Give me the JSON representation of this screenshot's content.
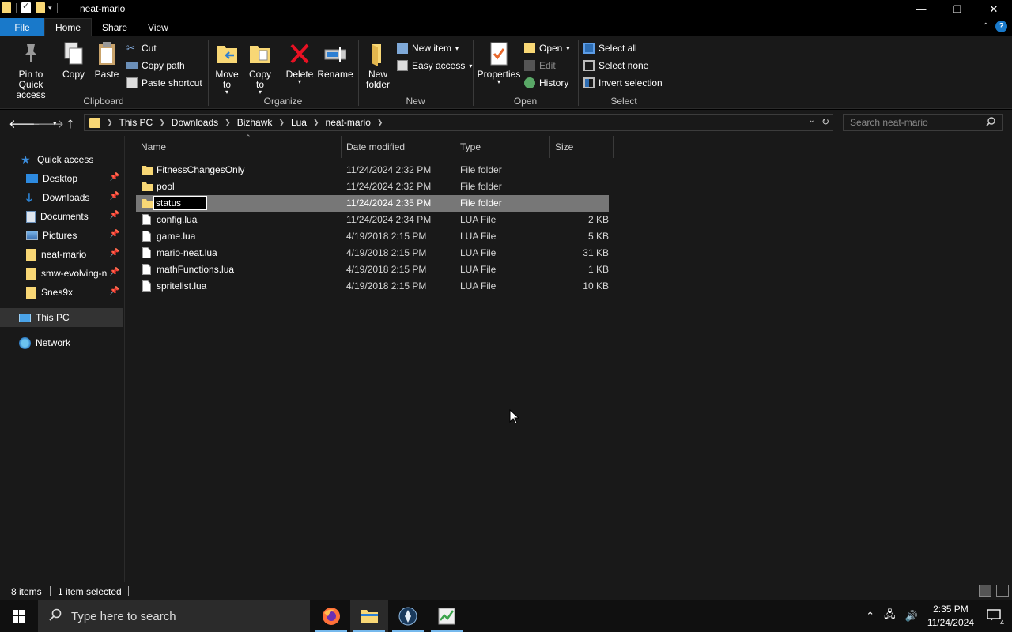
{
  "window": {
    "title": "neat-mario",
    "controls": [
      "—",
      "❐",
      "✕"
    ]
  },
  "ribbon_tabs": [
    "File",
    "Home",
    "Share",
    "View"
  ],
  "ribbon": {
    "clipboard": {
      "label": "Clipboard",
      "pin": "Pin to Quick access",
      "copy": "Copy",
      "paste": "Paste",
      "cut": "Cut",
      "copy_path": "Copy path",
      "paste_shortcut": "Paste shortcut"
    },
    "organize": {
      "label": "Organize",
      "move_to": "Move to",
      "copy_to": "Copy to",
      "delete": "Delete",
      "rename": "Rename"
    },
    "new": {
      "label": "New",
      "new_folder": "New folder",
      "new_item": "New item",
      "easy_access": "Easy access"
    },
    "open": {
      "label": "Open",
      "properties": "Properties",
      "open": "Open",
      "edit": "Edit",
      "history": "History"
    },
    "select": {
      "label": "Select",
      "select_all": "Select all",
      "select_none": "Select none",
      "invert": "Invert selection"
    }
  },
  "address": {
    "crumbs": [
      "This PC",
      "Downloads",
      "Bizhawk",
      "Lua",
      "neat-mario"
    ],
    "search_placeholder": "Search neat-mario"
  },
  "nav_pane": {
    "quick_access": "Quick access",
    "items": [
      {
        "label": "Desktop",
        "icon": "desktop-icon",
        "pinned": true
      },
      {
        "label": "Downloads",
        "icon": "download-icon",
        "pinned": true
      },
      {
        "label": "Documents",
        "icon": "documents-icon",
        "pinned": true
      },
      {
        "label": "Pictures",
        "icon": "pictures-icon",
        "pinned": true
      },
      {
        "label": "neat-mario",
        "icon": "folder-icon",
        "pinned": true
      },
      {
        "label": "smw-evolving-n",
        "icon": "folder-icon",
        "pinned": true
      },
      {
        "label": "Snes9x",
        "icon": "folder-icon",
        "pinned": true
      }
    ],
    "this_pc": "This PC",
    "network": "Network"
  },
  "columns": [
    "Name",
    "Date modified",
    "Type",
    "Size"
  ],
  "files": [
    {
      "name": "FitnessChangesOnly",
      "date": "11/24/2024 2:32 PM",
      "type": "File folder",
      "size": "",
      "kind": "folder"
    },
    {
      "name": "pool",
      "date": "11/24/2024 2:32 PM",
      "type": "File folder",
      "size": "",
      "kind": "folder"
    },
    {
      "name": "status",
      "date": "11/24/2024 2:35 PM",
      "type": "File folder",
      "size": "",
      "kind": "folder",
      "renaming": true
    },
    {
      "name": "config.lua",
      "date": "11/24/2024 2:34 PM",
      "type": "LUA File",
      "size": "2 KB",
      "kind": "file"
    },
    {
      "name": "game.lua",
      "date": "4/19/2018 2:15 PM",
      "type": "LUA File",
      "size": "5 KB",
      "kind": "file"
    },
    {
      "name": "mario-neat.lua",
      "date": "4/19/2018 2:15 PM",
      "type": "LUA File",
      "size": "31 KB",
      "kind": "file"
    },
    {
      "name": "mathFunctions.lua",
      "date": "4/19/2018 2:15 PM",
      "type": "LUA File",
      "size": "1 KB",
      "kind": "file"
    },
    {
      "name": "spritelist.lua",
      "date": "4/19/2018 2:15 PM",
      "type": "LUA File",
      "size": "10 KB",
      "kind": "file"
    }
  ],
  "status": {
    "count": "8 items",
    "selected": "1 item selected"
  },
  "taskbar": {
    "search_placeholder": "Type here to search",
    "time": "2:35 PM",
    "date": "11/24/2024",
    "notification_count": "4"
  },
  "colors": {
    "accent": "#1979ca",
    "folder": "#f8d775",
    "background": "#191919",
    "selection": "#777777"
  }
}
